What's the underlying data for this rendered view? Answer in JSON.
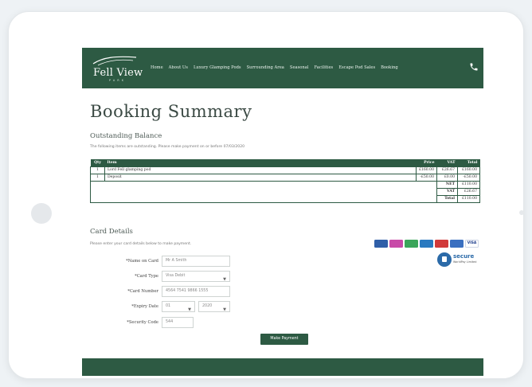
{
  "header": {
    "logo_text": "Fell View",
    "logo_sub": "PARK",
    "nav": [
      "Home",
      "About Us",
      "Luxury Glamping Pods",
      "Surrounding Area",
      "Seasonal",
      "Facilities",
      "Escape Pod Sales",
      "Booking"
    ]
  },
  "page": {
    "title": "Booking Summary",
    "outstanding_title": "Outstanding Balance",
    "outstanding_note": "The following items are outstanding. Please make payment on or before 07/03/2020"
  },
  "table": {
    "headers": [
      "Qty",
      "Item",
      "Price",
      "VAT",
      "Total"
    ],
    "rows": [
      [
        "1",
        "Lord Fell glamping pod",
        "£160.00",
        "£26.67",
        "£160.00"
      ],
      [
        "1",
        "Deposit",
        "-£50.00",
        "£0.00",
        "-£50.00"
      ]
    ],
    "summary": [
      {
        "label": "NET",
        "value": "£110.00"
      },
      {
        "label": "VAT",
        "value": "£26.67"
      },
      {
        "label": "Total",
        "value": "£110.00"
      }
    ]
  },
  "card": {
    "title": "Card Details",
    "note": "Please enter your card details below to make payment.",
    "fields": {
      "name_label": "*Name on Card",
      "name_placeholder": "Mr A Smith",
      "type_label": "*Card Type",
      "type_value": "Visa Debit",
      "number_label": "*Card Number",
      "number_placeholder": "4564 7541 9866 1555",
      "expiry_label": "*Expiry Date",
      "expiry_month": "01",
      "expiry_year": "2020",
      "security_label": "*Security Code",
      "security_placeholder": "544"
    },
    "button": "Make Payment",
    "card_logos": [
      "maestro-icon",
      "mastercard-icon",
      "visa-electron-icon",
      "solo-icon",
      "amex-icon",
      "visa-icon",
      "visa-text-icon"
    ],
    "card_colors": [
      "#2f5fa8",
      "#c84aa8",
      "#3aa55a",
      "#2a7ac0",
      "#d13a3a",
      "#3a6fc0"
    ],
    "card_text_color": "#1a3a8a",
    "secure_text": "secure",
    "secure_sub": "WorldPay Limited"
  },
  "colors": {
    "brand_green": "#2d5a43"
  }
}
